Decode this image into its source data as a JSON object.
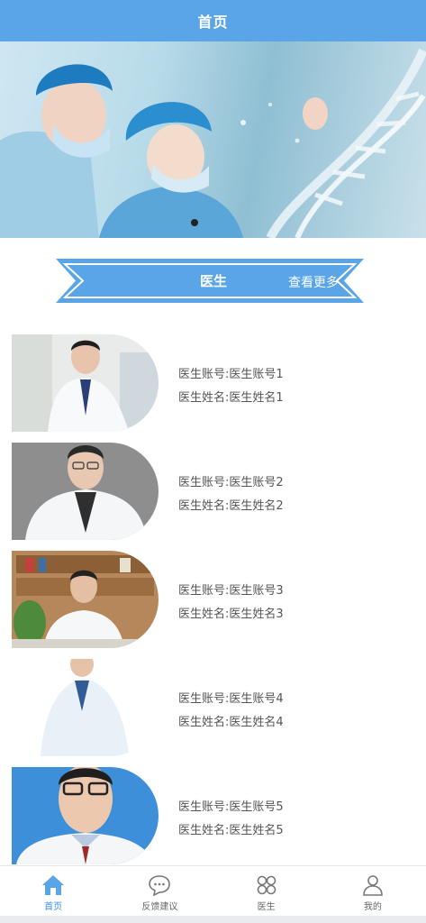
{
  "header": {
    "title": "首页"
  },
  "section": {
    "title": "医生",
    "more": "查看更多"
  },
  "doctors": [
    {
      "account": "医生账号:医生账号1",
      "name": "医生姓名:医生姓名1"
    },
    {
      "account": "医生账号:医生账号2",
      "name": "医生姓名:医生姓名2"
    },
    {
      "account": "医生账号:医生账号3",
      "name": "医生姓名:医生姓名3"
    },
    {
      "account": "医生账号:医生账号4",
      "name": "医生姓名:医生姓名4"
    },
    {
      "account": "医生账号:医生账号5",
      "name": "医生姓名:医生姓名5"
    }
  ],
  "tabbar": {
    "items": [
      {
        "label": "首页",
        "icon": "home-icon",
        "active": true
      },
      {
        "label": "反馈建议",
        "icon": "chat-bubble-icon",
        "active": false
      },
      {
        "label": "医生",
        "icon": "grid-icon",
        "active": false
      },
      {
        "label": "我的",
        "icon": "user-icon",
        "active": false
      }
    ]
  },
  "colors": {
    "primary": "#5aa4e8",
    "active_tab": "#3b8fe0",
    "text": "#555555"
  }
}
